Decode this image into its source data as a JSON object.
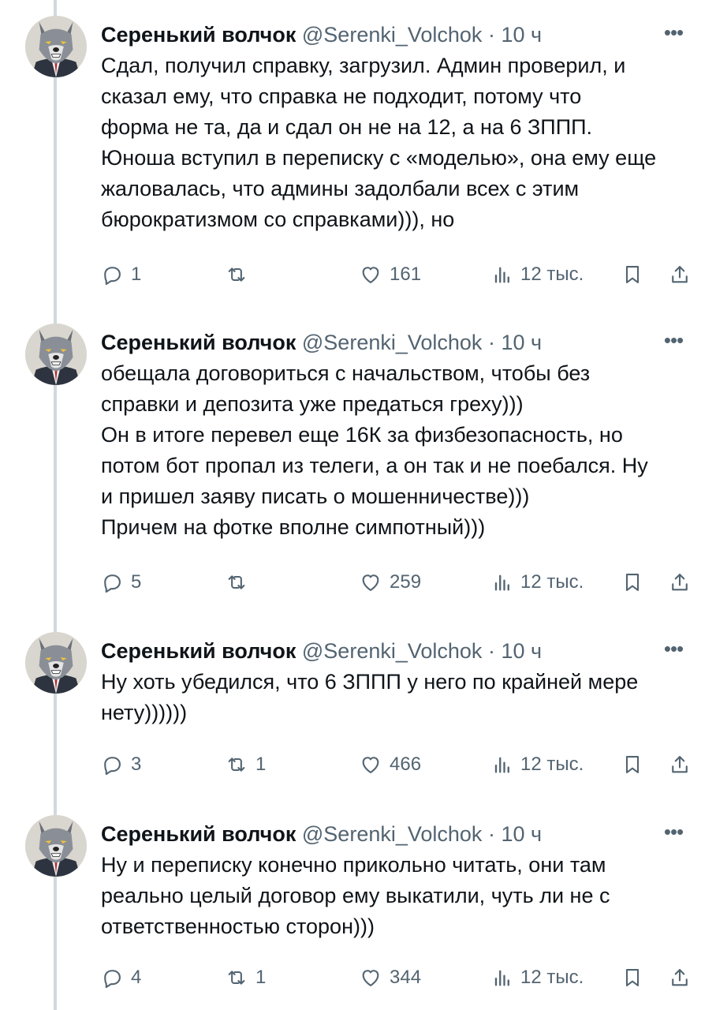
{
  "author": {
    "name": "Серенький волчок",
    "handle": "@Serenki_Volchok",
    "separator": "·"
  },
  "more_icon": "•••",
  "tweets": [
    {
      "time": "10 ч",
      "lines": [
        "Сдал, получил справку, загрузил. Админ проверил, и",
        "сказал ему, что справка не подходит, потому что",
        "форма не та, да и сдал он не на 12, а на 6 ЗППП.",
        "Юноша вступил в переписку с «моделью», она ему еще",
        "жаловалась, что админы задолбали всех с этим",
        "бюрократизмом со справками))), но"
      ],
      "replies": "1",
      "retweets": "",
      "likes": "161",
      "views": "12 тыс."
    },
    {
      "time": "10 ч",
      "lines": [
        "обещала договориться с начальством, чтобы без",
        "справки и депозита уже предаться греху)))",
        "Он в итоге перевел еще 16К за физбезопасность, но",
        "потом бот пропал из телеги, а он так и не поебался. Ну",
        "и пришел заяву писать о мошенничестве)))",
        "Причем на фотке вполне симпотный)))"
      ],
      "replies": "5",
      "retweets": "",
      "likes": "259",
      "views": "12 тыс."
    },
    {
      "time": "10 ч",
      "lines": [
        "Ну хоть убедился, что 6 ЗППП у него по крайней мере",
        "нету))))))"
      ],
      "replies": "3",
      "retweets": "1",
      "likes": "466",
      "views": "12 тыс."
    },
    {
      "time": "10 ч",
      "lines": [
        "Ну и переписку конечно прикольно читать, они там",
        "реально целый договор ему выкатили, чуть ли не с",
        "ответственностью сторон)))"
      ],
      "replies": "4",
      "retweets": "1",
      "likes": "344",
      "views": "12 тыс."
    }
  ],
  "icons": {
    "reply": "reply-icon",
    "retweet": "retweet-icon",
    "like": "heart-icon",
    "views": "views-icon",
    "bookmark": "bookmark-icon",
    "share": "share-icon",
    "avatar": "wolf-avatar"
  },
  "colors": {
    "text": "#0f1419",
    "secondary": "#536471",
    "thread_line": "#cfd9de",
    "background": "#ffffff"
  }
}
